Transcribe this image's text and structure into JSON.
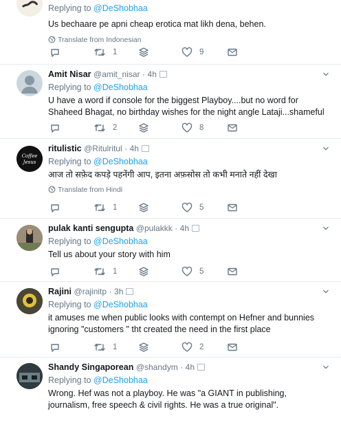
{
  "tweets": [
    {
      "name": "",
      "handle": "",
      "time": "",
      "reply_prefix": "Replying to",
      "reply_to": "@DeShobhaa",
      "text": "Us bechaare pe apni cheap erotica mat likh dena, behen.",
      "translate": "Translate from Indonesian",
      "replies": "",
      "retweets": "1",
      "likes": "9"
    },
    {
      "name": "Amit Nisar",
      "handle": "@amit_nisar",
      "time": "4h",
      "reply_prefix": "Replying to",
      "reply_to": "@DeShobhaa",
      "text": "U have a word if console for the biggest Playboy....but no word for Shaheed Bhagat, no birthday wishes for the night angle Lataji...shameful",
      "translate": "",
      "replies": "",
      "retweets": "2",
      "likes": "8"
    },
    {
      "name": "ritulistic",
      "handle": "@Ritulritul",
      "time": "4h",
      "reply_prefix": "Replying to",
      "reply_to": "@DeShobhaa",
      "text": "आज तो सफ़ेद कपड़े पहनेंगी आप, इतना अफ़सोस तो कभी मनाते नहीं देखा",
      "translate": "Translate from Hindi",
      "replies": "",
      "retweets": "1",
      "likes": "5"
    },
    {
      "name": "pulak kanti sengupta",
      "handle": "@pulakkk",
      "time": "4h",
      "reply_prefix": "Replying to",
      "reply_to": "@DeShobhaa",
      "text": "Tell us about your story with him",
      "translate": "",
      "replies": "",
      "retweets": "1",
      "likes": "5"
    },
    {
      "name": "Rajini",
      "handle": "@rajinitp",
      "time": "3h",
      "reply_prefix": "Replying to",
      "reply_to": "@DeShobhaa",
      "text": "it amuses me when public looks with contempt on Hefner and bunnies ignoring \"customers \" tht created the need in the first place",
      "translate": "",
      "replies": "",
      "retweets": "1",
      "likes": "2"
    },
    {
      "name": "Shandy Singaporean",
      "handle": "@shandym",
      "time": "4h",
      "reply_prefix": "Replying to",
      "reply_to": "@DeShobhaa",
      "text": "Wrong. Hef was not a playboy. He was \"a GIANT in publishing, journalism, free speech & civil rights. He was a true original\".",
      "translate": "",
      "replies": "",
      "retweets": "",
      "likes": ""
    }
  ],
  "avatars": [
    "avatar-1",
    "avatar-default",
    "avatar-coffee-jesus",
    "avatar-photo",
    "avatar-photo",
    "avatar-photo"
  ],
  "icons": [
    "reply-icon",
    "retweet-icon",
    "stack-icon",
    "heart-icon",
    "message-icon",
    "chevron-down-icon",
    "globe-icon"
  ],
  "colors": {
    "link": "#1da1f2",
    "muted": "#657786",
    "text": "#14171a",
    "border": "#e6ecf0"
  }
}
